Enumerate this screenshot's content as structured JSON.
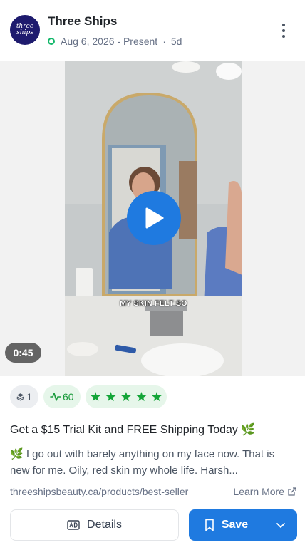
{
  "header": {
    "avatar_text_line1": "three",
    "avatar_text_line2": "ships",
    "brand_name": "Three Ships",
    "date_range": "Aug 6, 2026 - Present",
    "separator": "·",
    "age": "5d",
    "status_color": "#12b76a"
  },
  "media": {
    "duration": "0:45",
    "caption": "MY SKIN FELT SO",
    "play_color": "#1f7ae0"
  },
  "badges": {
    "variant_count": "1",
    "score": "60",
    "rating_stars": 5
  },
  "ad": {
    "headline": "Get a $15 Trial Kit and FREE Shipping Today 🌿",
    "body": "🌿 I go out with barely anything on my face now. That is new for me. Oily, red skin my whole life. Harsh...",
    "url": "threeshipsbeauty.ca/products/best-seller",
    "learn_more": "Learn More"
  },
  "actions": {
    "details_label": "Details",
    "save_label": "Save",
    "accent": "#1f7ae0"
  },
  "icons": [
    "layers-icon",
    "activity-icon",
    "star-icon",
    "external-link-icon",
    "ad-icon",
    "bookmark-icon",
    "chevron-down-icon",
    "play-icon",
    "more-vertical-icon"
  ]
}
